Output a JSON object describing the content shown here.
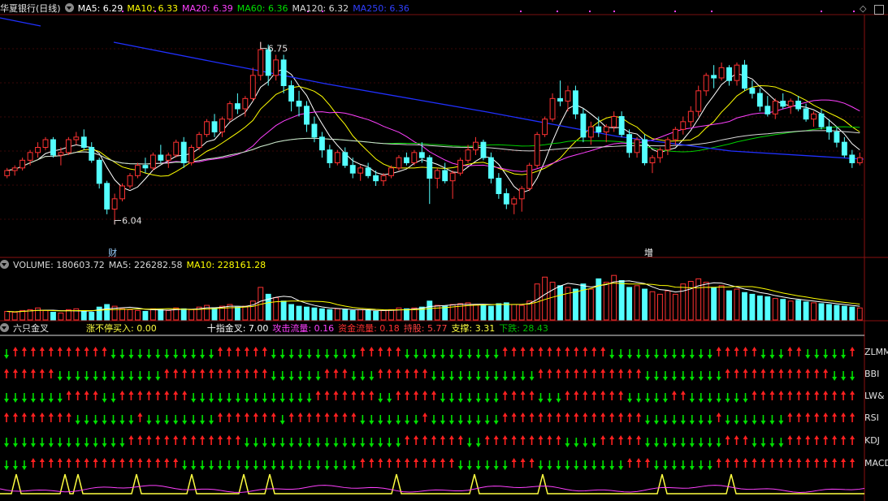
{
  "header": {
    "title": "华夏银行(日线)",
    "ma": [
      {
        "label": "MA5: 6.29",
        "color": "#ffffff"
      },
      {
        "label": "MA10: 6.33",
        "color": "#ffff00"
      },
      {
        "label": "MA20: 6.39",
        "color": "#ff40ff"
      },
      {
        "label": "MA60: 6.36",
        "color": "#00e000"
      },
      {
        "label": "MA120: 6.32",
        "color": "#d8d8d8"
      },
      {
        "label": "MA250: 6.36",
        "color": "#2f3fff"
      }
    ]
  },
  "price_annotations": {
    "high": "6.75",
    "low": "6.04",
    "tag_cai": "财",
    "tag_zeng": "增"
  },
  "volume_header": {
    "items": [
      {
        "label": "VOLUME: 180603.72",
        "color": "#d8d8d8"
      },
      {
        "label": "MA5: 226282.58",
        "color": "#d8d8d8"
      },
      {
        "label": "MA10: 228161.28",
        "color": "#ffff00"
      }
    ]
  },
  "indicator_header": {
    "name": "六只金叉",
    "items": [
      {
        "label": "涨不停买入: 0.00",
        "color": "#ffff40"
      },
      {
        "label": "十指金叉: 7.00",
        "color": "#ffffff"
      },
      {
        "label": "攻击流量: 0.16",
        "color": "#ff40ff"
      },
      {
        "label": "资金流量: 0.18",
        "color": "#ff3030"
      },
      {
        "label": "持股: 5.77",
        "color": "#ff4040"
      },
      {
        "label": "支撑: 3.31",
        "color": "#ffff40"
      },
      {
        "label": "下跌: 28.43",
        "color": "#00c000"
      }
    ]
  },
  "indicator_rows": [
    "ZLMM",
    "BBI",
    "LW&",
    "RSI",
    "KDJ",
    "MACD"
  ],
  "chart_data": {
    "type": "candlestick",
    "series_ma": [
      "MA5",
      "MA10",
      "MA20",
      "MA60",
      "MA120",
      "MA250"
    ],
    "ylim": [
      5.95,
      6.85
    ],
    "high": 6.75,
    "low": 6.04,
    "candles": [
      [
        6.23,
        6.26,
        6.22,
        6.25
      ],
      [
        6.25,
        6.27,
        6.23,
        6.26
      ],
      [
        6.26,
        6.3,
        6.25,
        6.29
      ],
      [
        6.29,
        6.33,
        6.27,
        6.32
      ],
      [
        6.32,
        6.36,
        6.3,
        6.34
      ],
      [
        6.34,
        6.38,
        6.33,
        6.37
      ],
      [
        6.37,
        6.38,
        6.3,
        6.31
      ],
      [
        6.31,
        6.34,
        6.27,
        6.32
      ],
      [
        6.32,
        6.38,
        6.31,
        6.37
      ],
      [
        6.37,
        6.4,
        6.35,
        6.38
      ],
      [
        6.38,
        6.41,
        6.33,
        6.34
      ],
      [
        6.34,
        6.36,
        6.28,
        6.29
      ],
      [
        6.29,
        6.3,
        6.18,
        6.2
      ],
      [
        6.2,
        6.21,
        6.08,
        6.1
      ],
      [
        6.1,
        6.16,
        6.04,
        6.14
      ],
      [
        6.14,
        6.2,
        6.13,
        6.19
      ],
      [
        6.19,
        6.24,
        6.18,
        6.23
      ],
      [
        6.23,
        6.28,
        6.22,
        6.27
      ],
      [
        6.27,
        6.3,
        6.24,
        6.26
      ],
      [
        6.26,
        6.32,
        6.25,
        6.31
      ],
      [
        6.31,
        6.35,
        6.28,
        6.29
      ],
      [
        6.29,
        6.32,
        6.26,
        6.31
      ],
      [
        6.31,
        6.37,
        6.3,
        6.36
      ],
      [
        6.36,
        6.38,
        6.26,
        6.28
      ],
      [
        6.28,
        6.35,
        6.27,
        6.34
      ],
      [
        6.34,
        6.4,
        6.33,
        6.39
      ],
      [
        6.39,
        6.45,
        6.38,
        6.44
      ],
      [
        6.44,
        6.47,
        6.38,
        6.4
      ],
      [
        6.4,
        6.46,
        6.38,
        6.45
      ],
      [
        6.45,
        6.52,
        6.44,
        6.51
      ],
      [
        6.51,
        6.55,
        6.47,
        6.49
      ],
      [
        6.49,
        6.54,
        6.46,
        6.53
      ],
      [
        6.53,
        6.65,
        6.52,
        6.62
      ],
      [
        6.62,
        6.75,
        6.6,
        6.72
      ],
      [
        6.72,
        6.74,
        6.58,
        6.62
      ],
      [
        6.62,
        6.7,
        6.6,
        6.68
      ],
      [
        6.68,
        6.7,
        6.55,
        6.58
      ],
      [
        6.58,
        6.6,
        6.48,
        6.52
      ],
      [
        6.52,
        6.56,
        6.46,
        6.5
      ],
      [
        6.5,
        6.52,
        6.4,
        6.43
      ],
      [
        6.43,
        6.46,
        6.36,
        6.38
      ],
      [
        6.38,
        6.4,
        6.3,
        6.33
      ],
      [
        6.33,
        6.35,
        6.26,
        6.28
      ],
      [
        6.28,
        6.33,
        6.27,
        6.32
      ],
      [
        6.32,
        6.34,
        6.26,
        6.27
      ],
      [
        6.27,
        6.3,
        6.22,
        6.24
      ],
      [
        6.24,
        6.27,
        6.21,
        6.26
      ],
      [
        6.26,
        6.28,
        6.22,
        6.23
      ],
      [
        6.23,
        6.25,
        6.19,
        6.21
      ],
      [
        6.21,
        6.24,
        6.19,
        6.23
      ],
      [
        6.23,
        6.27,
        6.22,
        6.26
      ],
      [
        6.26,
        6.31,
        6.25,
        6.3
      ],
      [
        6.3,
        6.32,
        6.27,
        6.28
      ],
      [
        6.28,
        6.33,
        6.27,
        6.32
      ],
      [
        6.32,
        6.36,
        6.28,
        6.3
      ],
      [
        6.3,
        6.31,
        6.12,
        6.22
      ],
      [
        6.22,
        6.26,
        6.18,
        6.25
      ],
      [
        6.25,
        6.28,
        6.2,
        6.21
      ],
      [
        6.21,
        6.25,
        6.14,
        6.24
      ],
      [
        6.24,
        6.3,
        6.23,
        6.29
      ],
      [
        6.29,
        6.35,
        6.28,
        6.33
      ],
      [
        6.33,
        6.38,
        6.31,
        6.36
      ],
      [
        6.36,
        6.37,
        6.29,
        6.3
      ],
      [
        6.3,
        6.32,
        6.2,
        6.22
      ],
      [
        6.22,
        6.24,
        6.14,
        6.16
      ],
      [
        6.16,
        6.18,
        6.1,
        6.12
      ],
      [
        6.12,
        6.15,
        6.08,
        6.14
      ],
      [
        6.14,
        6.19,
        6.09,
        6.18
      ],
      [
        6.18,
        6.28,
        6.17,
        6.27
      ],
      [
        6.27,
        6.4,
        6.26,
        6.39
      ],
      [
        6.39,
        6.46,
        6.38,
        6.45
      ],
      [
        6.45,
        6.55,
        6.44,
        6.53
      ],
      [
        6.53,
        6.6,
        6.5,
        6.52
      ],
      [
        6.52,
        6.58,
        6.48,
        6.56
      ],
      [
        6.56,
        6.58,
        6.45,
        6.47
      ],
      [
        6.47,
        6.49,
        6.36,
        6.38
      ],
      [
        6.38,
        6.44,
        6.35,
        6.42
      ],
      [
        6.42,
        6.46,
        6.38,
        6.4
      ],
      [
        6.4,
        6.43,
        6.36,
        6.42
      ],
      [
        6.42,
        6.48,
        6.4,
        6.46
      ],
      [
        6.46,
        6.48,
        6.38,
        6.39
      ],
      [
        6.39,
        6.41,
        6.3,
        6.32
      ],
      [
        6.32,
        6.38,
        6.3,
        6.37
      ],
      [
        6.37,
        6.39,
        6.27,
        6.28
      ],
      [
        6.28,
        6.31,
        6.24,
        6.3
      ],
      [
        6.3,
        6.34,
        6.28,
        6.33
      ],
      [
        6.33,
        6.38,
        6.31,
        6.37
      ],
      [
        6.37,
        6.42,
        6.35,
        6.41
      ],
      [
        6.41,
        6.46,
        6.39,
        6.44
      ],
      [
        6.44,
        6.5,
        6.42,
        6.48
      ],
      [
        6.48,
        6.58,
        6.46,
        6.56
      ],
      [
        6.56,
        6.63,
        6.54,
        6.62
      ],
      [
        6.62,
        6.66,
        6.57,
        6.61
      ],
      [
        6.61,
        6.67,
        6.6,
        6.65
      ],
      [
        6.65,
        6.66,
        6.58,
        6.6
      ],
      [
        6.6,
        6.67,
        6.58,
        6.66
      ],
      [
        6.66,
        6.68,
        6.56,
        6.57
      ],
      [
        6.57,
        6.6,
        6.53,
        6.55
      ],
      [
        6.55,
        6.57,
        6.48,
        6.5
      ],
      [
        6.5,
        6.54,
        6.46,
        6.47
      ],
      [
        6.47,
        6.53,
        6.45,
        6.52
      ],
      [
        6.52,
        6.55,
        6.49,
        6.5
      ],
      [
        6.5,
        6.53,
        6.47,
        6.52
      ],
      [
        6.52,
        6.54,
        6.48,
        6.49
      ],
      [
        6.49,
        6.51,
        6.44,
        6.45
      ],
      [
        6.45,
        6.48,
        6.42,
        6.47
      ],
      [
        6.47,
        6.49,
        6.41,
        6.42
      ],
      [
        6.42,
        6.45,
        6.37,
        6.4
      ],
      [
        6.4,
        6.42,
        6.34,
        6.36
      ],
      [
        6.36,
        6.38,
        6.3,
        6.31
      ],
      [
        6.31,
        6.33,
        6.26,
        6.28
      ],
      [
        6.28,
        6.32,
        6.27,
        6.3
      ]
    ],
    "volume": [
      10,
      9,
      11,
      12,
      14,
      11,
      9,
      8,
      12,
      13,
      10,
      9,
      15,
      18,
      16,
      13,
      12,
      11,
      10,
      13,
      12,
      11,
      14,
      13,
      12,
      15,
      17,
      14,
      16,
      18,
      15,
      16,
      22,
      38,
      30,
      26,
      22,
      18,
      16,
      15,
      14,
      13,
      12,
      13,
      12,
      11,
      12,
      11,
      10,
      11,
      12,
      14,
      13,
      14,
      15,
      22,
      17,
      16,
      18,
      19,
      20,
      18,
      17,
      16,
      19,
      20,
      18,
      17,
      22,
      42,
      50,
      44,
      40,
      38,
      36,
      42,
      36,
      48,
      44,
      52,
      46,
      38,
      40,
      36,
      33,
      30,
      34,
      30,
      42,
      45,
      48,
      44,
      38,
      40,
      34,
      36,
      32,
      30,
      28,
      27,
      25,
      24,
      22,
      23,
      21,
      20,
      19,
      18,
      17,
      16,
      15,
      14
    ]
  }
}
